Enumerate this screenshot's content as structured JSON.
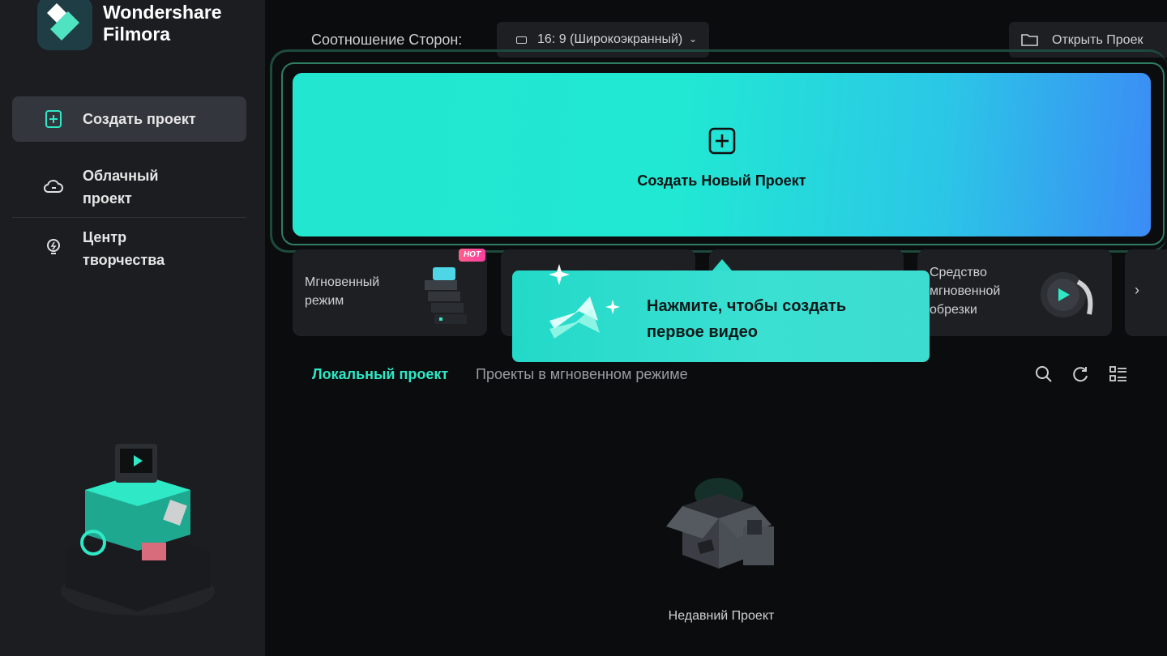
{
  "app": {
    "brand_line1": "Wondershare",
    "brand_line2": "Filmora",
    "logo_icon": "filmora-logo-icon"
  },
  "sidebar": {
    "items": [
      {
        "label": "Создать проект",
        "icon": "plus-square-icon",
        "active": true
      },
      {
        "label_line1": "Облачный",
        "label_line2": "проект",
        "icon": "cloud-icon"
      },
      {
        "label_line1": "Центр",
        "label_line2": "творчества",
        "icon": "lightbulb-icon"
      }
    ]
  },
  "header": {
    "aspect_label": "Соотношение Сторон:",
    "aspect_value": "16: 9 (Широкоэкранный)",
    "open_project": "Открыть Проек"
  },
  "create": {
    "label": "Создать Новый Проект"
  },
  "tools": [
    {
      "line1": "Мгновенный",
      "line2": "режим",
      "badge": "HOT"
    },
    {
      "line1": "Средство",
      "line2": "мгновенной",
      "line3": "обрезки"
    }
  ],
  "tooltip": {
    "line1": "Нажмите, чтобы создать",
    "line2": "первое видео"
  },
  "tabs": {
    "local": "Локальный проект",
    "instant": "Проекты в мгновенном режиме"
  },
  "empty": {
    "label": "Недавний Проект"
  },
  "colors": {
    "accent": "#2ee8c6",
    "sidebar_bg": "#1b1d21",
    "main_bg": "#0b0c0e",
    "card_bg": "#1d1f23"
  }
}
